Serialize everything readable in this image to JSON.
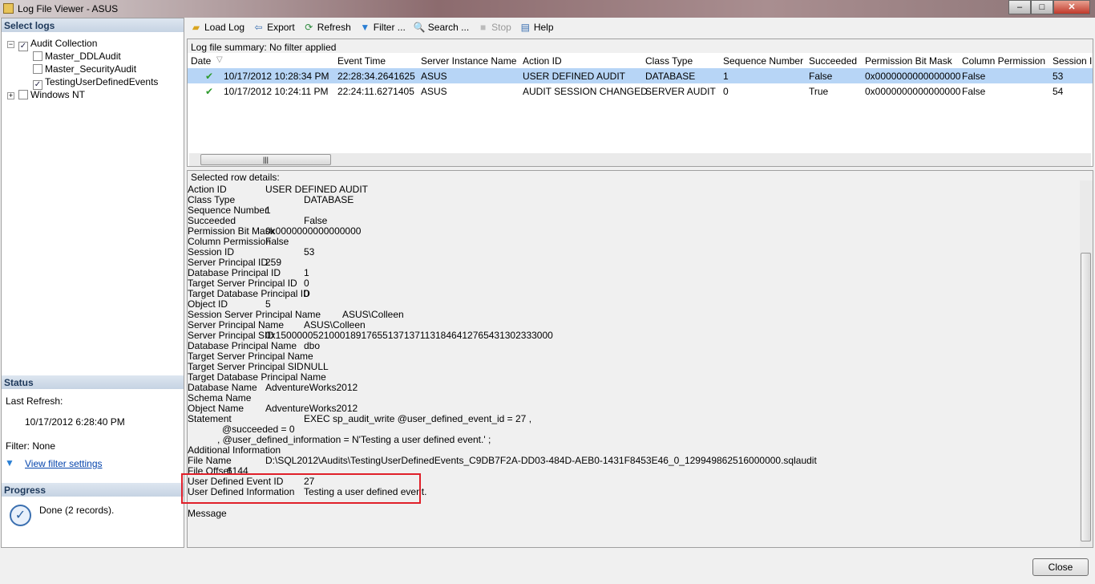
{
  "window": {
    "title": "Log File Viewer - ASUS",
    "minimize": "–",
    "maximize": "□",
    "close": "✕"
  },
  "left": {
    "select_logs": "Select logs",
    "tree": [
      {
        "label": "Audit Collection",
        "checked": true,
        "expander": "−"
      },
      {
        "label": "Master_DDLAudit",
        "checked": false
      },
      {
        "label": "Master_SecurityAudit",
        "checked": false
      },
      {
        "label": "TestingUserDefinedEvents",
        "checked": true
      },
      {
        "label": "Windows NT",
        "checked": false,
        "expander": "+"
      }
    ],
    "status_title": "Status",
    "last_refresh_label": "Last Refresh:",
    "last_refresh_value": "10/17/2012 6:28:40 PM",
    "filter": "Filter: None",
    "view_filter": "View filter settings",
    "progress_title": "Progress",
    "progress_text": "Done (2 records)."
  },
  "toolbar": [
    {
      "label": "Load Log",
      "icon": "folder-icon"
    },
    {
      "label": "Export",
      "icon": "export-icon"
    },
    {
      "label": "Refresh",
      "icon": "refresh-icon"
    },
    {
      "label": "Filter ...",
      "icon": "filter-icon"
    },
    {
      "label": "Search ...",
      "icon": "search-icon"
    },
    {
      "label": "Stop",
      "icon": "stop-icon",
      "disabled": true
    },
    {
      "label": "Help",
      "icon": "help-icon"
    }
  ],
  "grid": {
    "summary": "Log file summary: No filter applied",
    "columns": [
      "Date",
      "Event Time",
      "Server Instance Name",
      "Action ID",
      "Class Type",
      "Sequence Number",
      "Succeeded",
      "Permission Bit Mask",
      "Column Permission",
      "Session ID"
    ],
    "rows": [
      [
        "10/17/2012 10:28:34 PM",
        "22:28:34.2641625",
        "ASUS",
        "USER DEFINED AUDIT",
        "DATABASE",
        "1",
        "False",
        "0x0000000000000000",
        "False",
        "53"
      ],
      [
        "10/17/2012 10:24:11 PM",
        "22:24:11.6271405",
        "ASUS",
        "AUDIT SESSION CHANGED",
        "SERVER AUDIT",
        "0",
        "True",
        "0x0000000000000000",
        "False",
        "54"
      ]
    ],
    "selected_row": 0
  },
  "details": {
    "title": "Selected row details:",
    "lines": [
      [
        "Action ID",
        "USER DEFINED AUDIT"
      ],
      [
        "Class Type",
        "DATABASE"
      ],
      [
        "Sequence Number",
        "1"
      ],
      [
        "Succeeded",
        "False"
      ],
      [
        "Permission Bit Mask",
        "0x0000000000000000"
      ],
      [
        "Column Permission",
        "False"
      ],
      [
        "Session ID",
        "53"
      ],
      [
        "Server Principal ID",
        "259"
      ],
      [
        "Database Principal ID",
        "1"
      ],
      [
        "Target Server Principal ID",
        "0"
      ],
      [
        "Target Database Principal ID",
        "0"
      ],
      [
        "Object ID",
        "5"
      ],
      [
        "Session Server Principal Name",
        "ASUS\\Colleen"
      ],
      [
        "Server Principal Name",
        "ASUS\\Colleen"
      ],
      [
        "Server Principal SID",
        "0x1500000521000189176551371371131846412765431302333000"
      ],
      [
        "Database Principal Name",
        "dbo"
      ],
      [
        "Target Server Principal Name",
        ""
      ],
      [
        "Target Server Principal SID",
        "NULL"
      ],
      [
        "Target Database Principal Name",
        ""
      ],
      [
        "Database Name",
        "AdventureWorks2012"
      ],
      [
        "Schema Name",
        ""
      ],
      [
        "Object Name",
        "AdventureWorks2012"
      ],
      [
        "Statement",
        "EXEC sp_audit_write @user_defined_event_id =  27 ,"
      ],
      [
        "",
        "@succeeded =  0"
      ],
      [
        "",
        ", @user_defined_information = N'Testing a user defined event.' ;"
      ],
      [
        "Additional Information",
        ""
      ],
      [
        "File Name",
        "D:\\SQL2012\\Audits\\TestingUserDefinedEvents_C9DB7F2A-DD03-484D-AEB0-1431F8453E46_0_129949862516000000.sqlaudit"
      ],
      [
        "File Offset",
        "6144"
      ],
      [
        "User Defined Event ID",
        "27"
      ],
      [
        "User Defined Information",
        "Testing a user defined event."
      ]
    ],
    "message_label": "Message"
  },
  "close_button": "Close",
  "colors": {
    "selection": "#b7d5f6",
    "highlight_box": "#e0202a",
    "check": "#2e9a2e"
  }
}
